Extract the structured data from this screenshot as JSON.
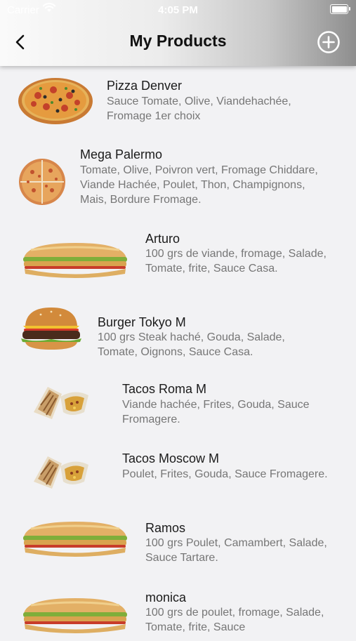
{
  "status_bar": {
    "carrier": "Carrier",
    "time": "4:05 PM"
  },
  "nav": {
    "title": "My Products"
  },
  "products": [
    {
      "name": "Pizza Denver",
      "description": "Sauce Tomate, Olive, Viandehachée, Fromage 1er choix",
      "image": "pizza"
    },
    {
      "name": "Mega Palermo",
      "description": "Tomate, Olive, Poivron vert, Fromage Chiddare, Viande Hachée, Poulet, Thon, Champignons, Mais, Bordure Fromage.",
      "image": "pizza-slices"
    },
    {
      "name": "Arturo",
      "description": "100 grs de viande, fromage, Salade, Tomate, frite, Sauce Casa.",
      "image": "sandwich"
    },
    {
      "name": "Burger Tokyo M",
      "description": "100 grs Steak haché, Gouda, Salade, Tomate, Oignons, Sauce Casa.",
      "image": "burger"
    },
    {
      "name": "Tacos Roma M",
      "description": "Viande hachée, Frites, Gouda, Sauce Fromagere.",
      "image": "tacos"
    },
    {
      "name": "Tacos Moscow M",
      "description": "Poulet, Frites, Gouda, Sauce Fromagere.",
      "image": "tacos"
    },
    {
      "name": "Ramos",
      "description": "100 grs Poulet, Camambert, Salade, Sauce Tartare.",
      "image": "sandwich"
    },
    {
      "name": "monica",
      "description": "100 grs de poulet, fromage, Salade, Tomate, frite, Sauce",
      "image": "sandwich"
    }
  ]
}
